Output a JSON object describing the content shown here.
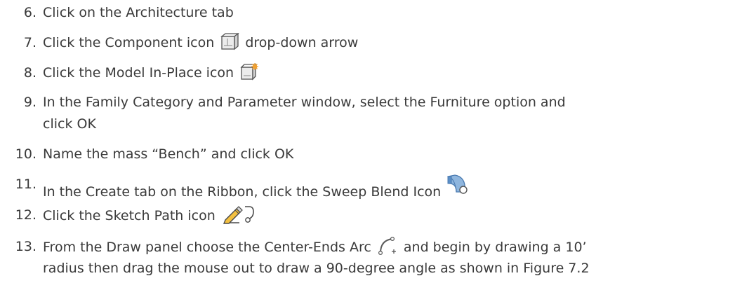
{
  "steps": [
    {
      "num": "6.",
      "parts": [
        "Click on the Architecture tab"
      ]
    },
    {
      "num": "7.",
      "parts": [
        "Click the Component icon ",
        " drop-down arrow"
      ],
      "icon": "component-icon"
    },
    {
      "num": "8.",
      "parts": [
        "Click the Model In-Place icon "
      ],
      "icon": "model-in-place-icon"
    },
    {
      "num": "9.",
      "lines": [
        "In the Family Category and Parameter window, select the Furniture option and",
        "click OK"
      ]
    },
    {
      "num": "10.",
      "parts": [
        "Name the mass “Bench” and click OK"
      ]
    },
    {
      "num": "11.",
      "parts": [
        "In the Create tab on the Ribbon, click the Sweep Blend Icon "
      ],
      "icon": "sweep-blend-icon"
    },
    {
      "num": "12.",
      "parts": [
        "Click the Sketch Path icon "
      ],
      "icon": "sketch-path-icon"
    },
    {
      "num": "13.",
      "lines": [
        "From the Draw panel choose the Center-Ends Arc ",
        " and begin by drawing a 10’",
        "radius then drag the mouse out to draw a 90-degree angle as shown in Figure 7.2"
      ],
      "icon": "center-ends-arc-icon"
    }
  ],
  "colors": {
    "text": "#3a3a3a",
    "icon_blue": "#5b8fc7",
    "icon_gray": "#9a9a9a",
    "icon_orange": "#f0a030"
  }
}
